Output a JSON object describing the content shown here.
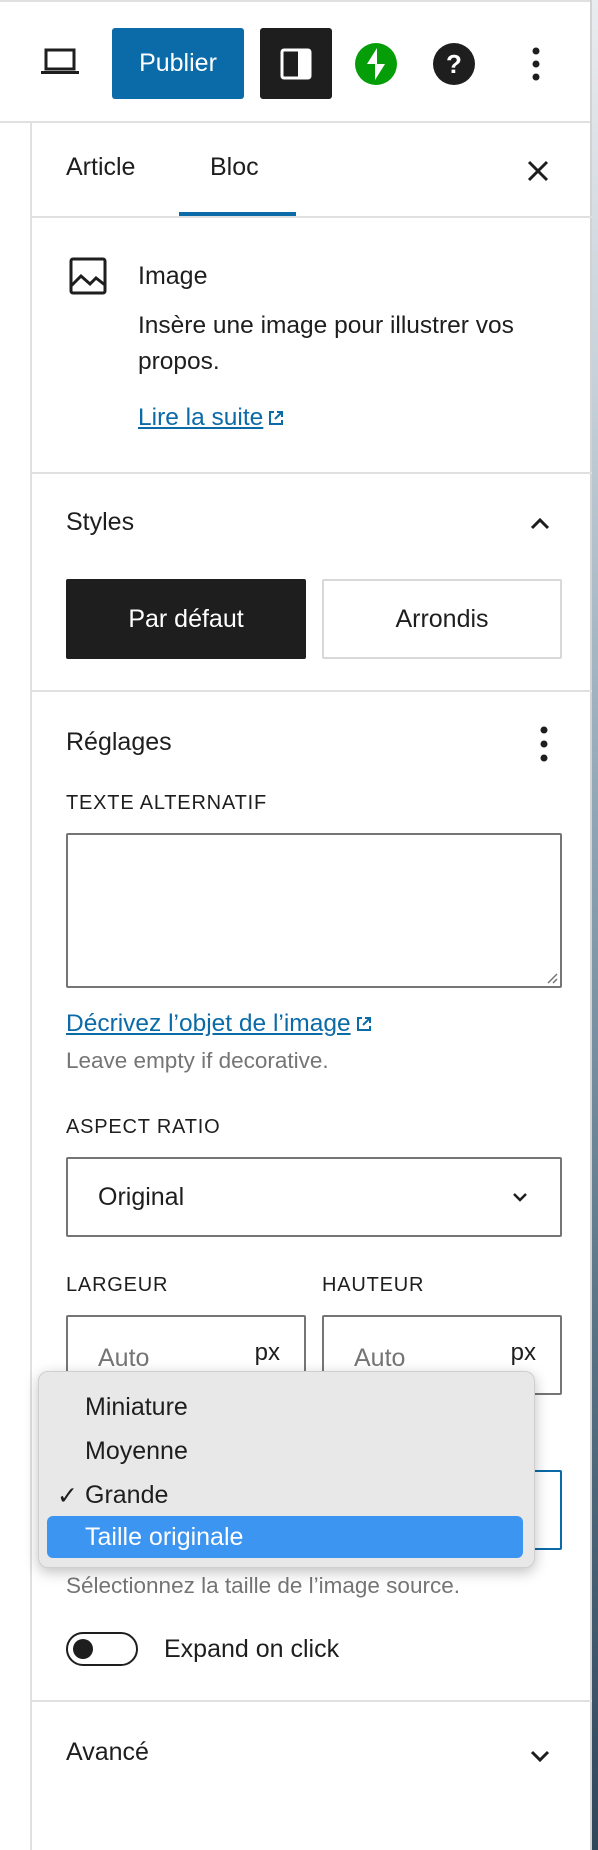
{
  "toolbar": {
    "publish_label": "Publier"
  },
  "sidebar": {
    "tabs": [
      {
        "label": "Article"
      },
      {
        "label": "Bloc"
      }
    ],
    "active_tab": "Bloc"
  },
  "block": {
    "name": "Image",
    "description": "Insère une image pour illustrer vos propos.",
    "read_more": "Lire la suite"
  },
  "styles": {
    "title": "Styles",
    "options": [
      {
        "label": "Par défaut",
        "selected": true
      },
      {
        "label": "Arrondis",
        "selected": false
      }
    ]
  },
  "settings": {
    "title": "Réglages",
    "alt_text_label": "TEXTE ALTERNATIF",
    "alt_text_value": "",
    "alt_link": "Décrivez l’objet de l’image",
    "alt_help": "Leave empty if decorative.",
    "aspect_label": "ASPECT RATIO",
    "aspect_value": "Original",
    "width_label": "LARGEUR",
    "height_label": "HAUTEUR",
    "width_placeholder": "Auto",
    "height_placeholder": "Auto",
    "unit": "px",
    "size_help": "Sélectionnez la taille de l’image source.",
    "expand_label": "Expand on click",
    "expand_on": false
  },
  "size_dropdown": {
    "options": [
      {
        "label": "Miniature"
      },
      {
        "label": "Moyenne"
      },
      {
        "label": "Grande",
        "checked": true
      },
      {
        "label": "Taille originale",
        "highlighted": true
      }
    ],
    "checkmark": "✓"
  },
  "advanced": {
    "title": "Avancé"
  },
  "colors": {
    "accent": "#0b6aa8",
    "dark": "#1e1e1e",
    "highlight": "#3d95f2"
  }
}
